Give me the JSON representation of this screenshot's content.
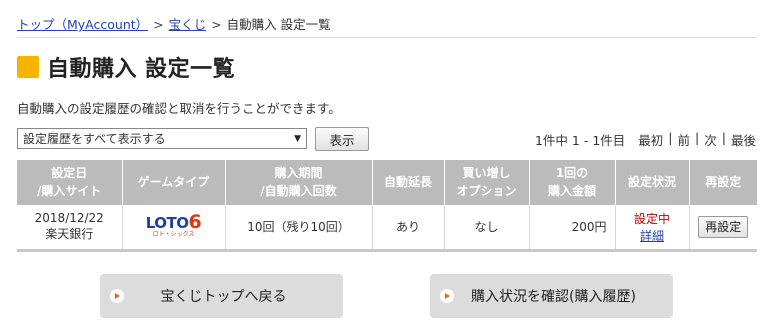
{
  "breadcrumb": {
    "home": "トップ（MyAccount）",
    "lottery": "宝くじ",
    "current": "自動購入 設定一覧",
    "sep": ">"
  },
  "page_title": "自動購入 設定一覧",
  "description": "自動購入の設定履歴の確認と取消を行うことができます。",
  "filter": {
    "selected": "設定履歴をすべて表示する",
    "show_button": "表示"
  },
  "pager": {
    "count": "1件中 1 - 1件目",
    "first": "最初",
    "prev": "前",
    "next": "次",
    "last": "最後",
    "divider": "|"
  },
  "table": {
    "headers": [
      [
        "設定日",
        "/購入サイト"
      ],
      [
        "ゲームタイプ"
      ],
      [
        "購入期間",
        "/自動購入回数"
      ],
      [
        "自動延長"
      ],
      [
        "買い増し",
        "オプション"
      ],
      [
        "1回の",
        "購入金額"
      ],
      [
        "設定状況"
      ],
      [
        "再設定"
      ]
    ],
    "rows": [
      {
        "date": "2018/12/22",
        "site": "楽天銀行",
        "game_logo": {
          "main": "LOTO",
          "number": "6",
          "sub": "ロト・シックス"
        },
        "period": "10回（残り10回）",
        "auto_extend": "あり",
        "option": "なし",
        "amount": "200円",
        "status": "設定中",
        "detail": "詳細",
        "reset": "再設定"
      }
    ]
  },
  "buttons": {
    "back": "宝くじトップへ戻る",
    "history": "購入状況を確認(購入履歴)"
  },
  "colors": {
    "accent": "#f5b400",
    "link": "#2443b0",
    "status": "#c00000",
    "header_bg": "#bbbbbb"
  }
}
